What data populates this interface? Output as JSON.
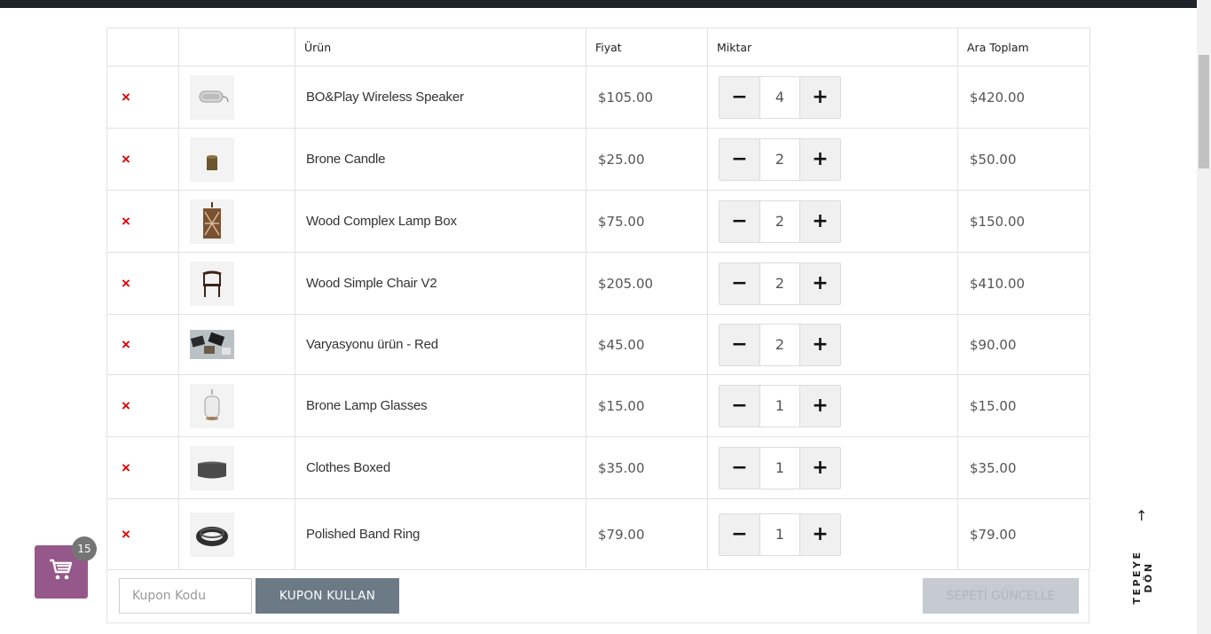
{
  "table": {
    "headers": {
      "remove": "",
      "thumb": "",
      "product": "Ürün",
      "price": "Fiyat",
      "quantity": "Miktar",
      "subtotal": "Ara Toplam"
    },
    "remove_symbol": "×",
    "rows": [
      {
        "name": "BO&Play Wireless Speaker",
        "price": "$105.00",
        "qty": "4",
        "subtotal": "$420.00",
        "image": "speaker"
      },
      {
        "name": "Brone Candle",
        "price": "$25.00",
        "qty": "2",
        "subtotal": "$50.00",
        "image": "candle"
      },
      {
        "name": "Wood Complex Lamp Box",
        "price": "$75.00",
        "qty": "2",
        "subtotal": "$150.00",
        "image": "lamp-box"
      },
      {
        "name": "Wood Simple Chair V2",
        "price": "$205.00",
        "qty": "2",
        "subtotal": "$410.00",
        "image": "chair"
      },
      {
        "name": "Varyasyonu ürün - Red",
        "price": "$45.00",
        "qty": "2",
        "subtotal": "$90.00",
        "image": "desk-items"
      },
      {
        "name": "Brone Lamp Glasses",
        "price": "$15.00",
        "qty": "1",
        "subtotal": "$15.00",
        "image": "lamp-glass"
      },
      {
        "name": "Clothes Boxed",
        "price": "$35.00",
        "qty": "1",
        "subtotal": "$35.00",
        "image": "box"
      },
      {
        "name": "Polished Band Ring",
        "price": "$79.00",
        "qty": "1",
        "subtotal": "$79.00",
        "image": "ring"
      }
    ],
    "minus_symbol": "−",
    "plus_symbol": "+"
  },
  "actions": {
    "coupon_placeholder": "Kupon Kodu",
    "coupon_button": "KUPON KULLAN",
    "update_button": "SEPETİ GÜNCELLE"
  },
  "floating_cart": {
    "count": "15",
    "icon": "cart-icon",
    "color": "#96588a"
  },
  "back_to_top": {
    "label": "TEPEYE DÖN",
    "arrow": "↑"
  }
}
